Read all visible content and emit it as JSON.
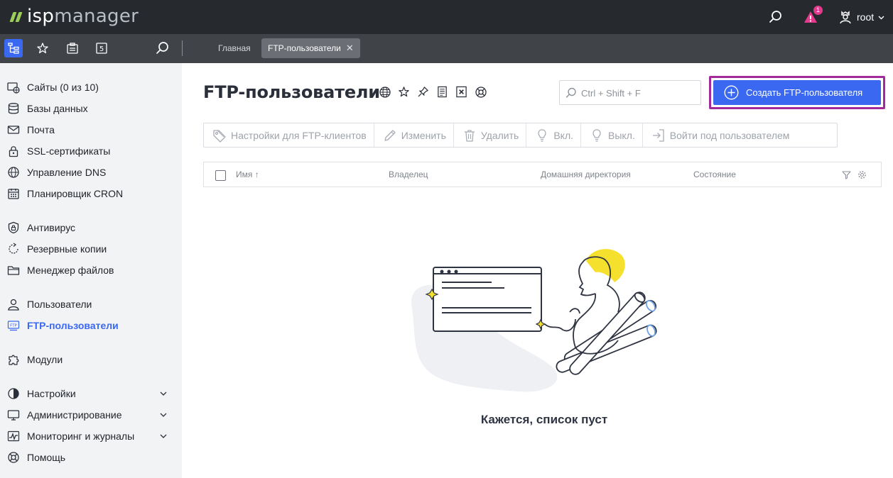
{
  "app": {
    "brand_prefix": "isp",
    "brand_suffix": "manager"
  },
  "topbar": {
    "notifications_count": "1",
    "user_name": "root",
    "icons": [
      "search-icon",
      "alert-icon",
      "user-icon",
      "chevron-down-icon"
    ]
  },
  "subbar": {
    "icons": [
      "tree-menu-icon",
      "star-icon",
      "clipboard-icon",
      "five-icon",
      "search-icon"
    ],
    "five_label": "5",
    "tabs": [
      {
        "label": "Главная"
      },
      {
        "label": "FTP-пользователи",
        "closable": true
      }
    ]
  },
  "sidebar": {
    "items": [
      {
        "label": "Сайты (0 из 10)",
        "icon": "sites-icon"
      },
      {
        "label": "Базы данных",
        "icon": "database-icon"
      },
      {
        "label": "Почта",
        "icon": "mail-icon"
      },
      {
        "label": "SSL-сертификаты",
        "icon": "lock-icon"
      },
      {
        "label": "Управление DNS",
        "icon": "dns-icon"
      },
      {
        "label": "Планировщик CRON",
        "icon": "calendar-icon"
      },
      {
        "label": "Антивирус",
        "icon": "shield-icon"
      },
      {
        "label": "Резервные копии",
        "icon": "backup-icon"
      },
      {
        "label": "Менеджер файлов",
        "icon": "folder-icon"
      },
      {
        "label": "Пользователи",
        "icon": "user-icon"
      },
      {
        "label": "FTP-пользователи",
        "icon": "ftp-icon",
        "active": true
      },
      {
        "label": "Модули",
        "icon": "puzzle-icon"
      },
      {
        "label": "Настройки",
        "icon": "settings-icon",
        "expandable": true
      },
      {
        "label": "Администрирование",
        "icon": "monitor-icon",
        "expandable": true
      },
      {
        "label": "Мониторинг и журналы",
        "icon": "pulse-icon",
        "expandable": true
      },
      {
        "label": "Помощь",
        "icon": "help-icon"
      }
    ]
  },
  "main": {
    "title": "FTP-пользователи",
    "title_icons": [
      "globe-icon",
      "star-icon",
      "pin-icon",
      "doc-icon",
      "excel-icon",
      "lifebuoy-icon"
    ],
    "search": {
      "placeholder": "Ctrl + Shift + F",
      "value": ""
    },
    "create_button": "Создать FTP-пользователя",
    "toolbar": [
      {
        "label": "Настройки для FTP-клиентов",
        "icon": "tag-icon"
      },
      {
        "label": "Изменить",
        "icon": "pencil-icon"
      },
      {
        "label": "Удалить",
        "icon": "trash-icon"
      },
      {
        "label": "Вкл.",
        "icon": "bulb-on-icon"
      },
      {
        "label": "Выкл.",
        "icon": "bulb-off-icon"
      },
      {
        "label": "Войти под пользователем",
        "icon": "login-icon"
      }
    ],
    "table": {
      "columns": [
        "Имя ↑",
        "Владелец",
        "Домашняя директория",
        "Состояние"
      ],
      "tools": [
        "filter-icon",
        "gear-icon"
      ],
      "rows": []
    },
    "empty_text": "Кажется, список пуст"
  },
  "colors": {
    "topbar_bg": "#26292e",
    "subbar_bg": "#404348",
    "sidebar_bg": "#f2f3f5",
    "accent": "#3a68f0",
    "create_outline": "#a32a9a",
    "badge": "#e23a8c",
    "illustration_yellow": "#f5e02e"
  }
}
